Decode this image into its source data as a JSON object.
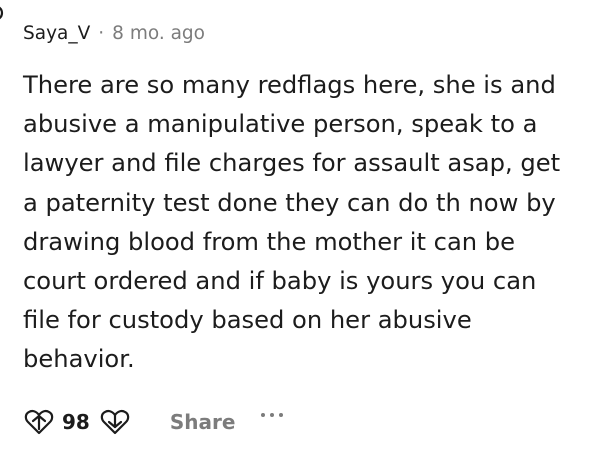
{
  "comment": {
    "username": "Saya_V",
    "separator": "·",
    "time": "8 mo. ago",
    "body": "There are so many redflags here, she is and\nabusive a manipulative person, speak to a\nlawyer and file charges for assault asap, get\na paternity test done they can do th now by\ndrawing blood from the mother it can be\ncourt ordered and if baby is yours you can\nfile for custody based on her abusive\nbehavior.",
    "score": "98",
    "share_label": "Share"
  },
  "icons": {
    "upvote": "upvote-heart-icon",
    "downvote": "downvote-heart-icon",
    "more": "more-options-icon"
  },
  "colors": {
    "text": "#1c1c1c",
    "muted": "#7c7c7c",
    "background": "#ffffff"
  }
}
